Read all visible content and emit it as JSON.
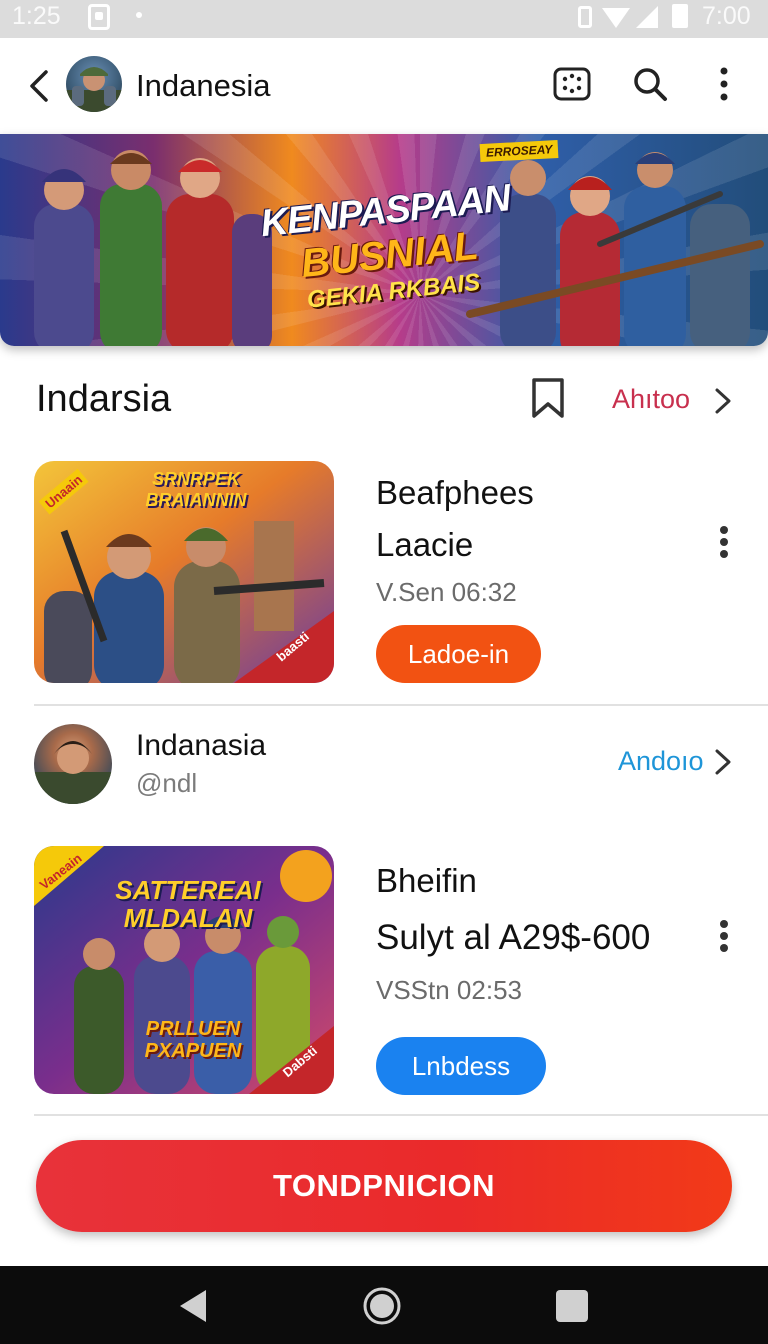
{
  "status_bar": {
    "time_left": "1:25",
    "time_right": "7:00"
  },
  "toolbar": {
    "title": "Indanesia"
  },
  "banner": {
    "badge": "ERROSEAY",
    "line1": "KENPASPAAN",
    "line2": "BUSNIAL",
    "line3": "GEKIA RKBAIS"
  },
  "section": {
    "title": "Indarsia",
    "link_label": "Ahıtoo"
  },
  "cards": [
    {
      "thumb_title": "SRNRPEK BRAIANNIN",
      "thumb_tag_top": "Unaain",
      "thumb_tag_bottom": "baasti",
      "title_line1": "Beafphees",
      "title_line2": "Laacie",
      "meta": "V.Sen 06:32",
      "button_label": "Ladoe-in",
      "button_color": "#f25212"
    },
    {
      "thumb_title": "SATTEREAI MLDALAN",
      "thumb_subtitle": "PRLLUEN PXAPUEN",
      "thumb_tag_top": "Vaneain",
      "thumb_tag_bottom": "Dabsti",
      "title_line1": "Bheifin",
      "title_line2": "Sulyt al A29$-600",
      "meta": "VSStn 02:53",
      "button_label": "Lnbdess",
      "button_color": "#1a82f0"
    }
  ],
  "author": {
    "name": "Indanasia",
    "handle": "@ndl",
    "link_label": "Andoıo"
  },
  "cta": {
    "label": "TONDPNICION"
  },
  "colors": {
    "accent_red": "#e8323a",
    "accent_pink": "#c8304e",
    "link_blue": "#1e95d8"
  }
}
